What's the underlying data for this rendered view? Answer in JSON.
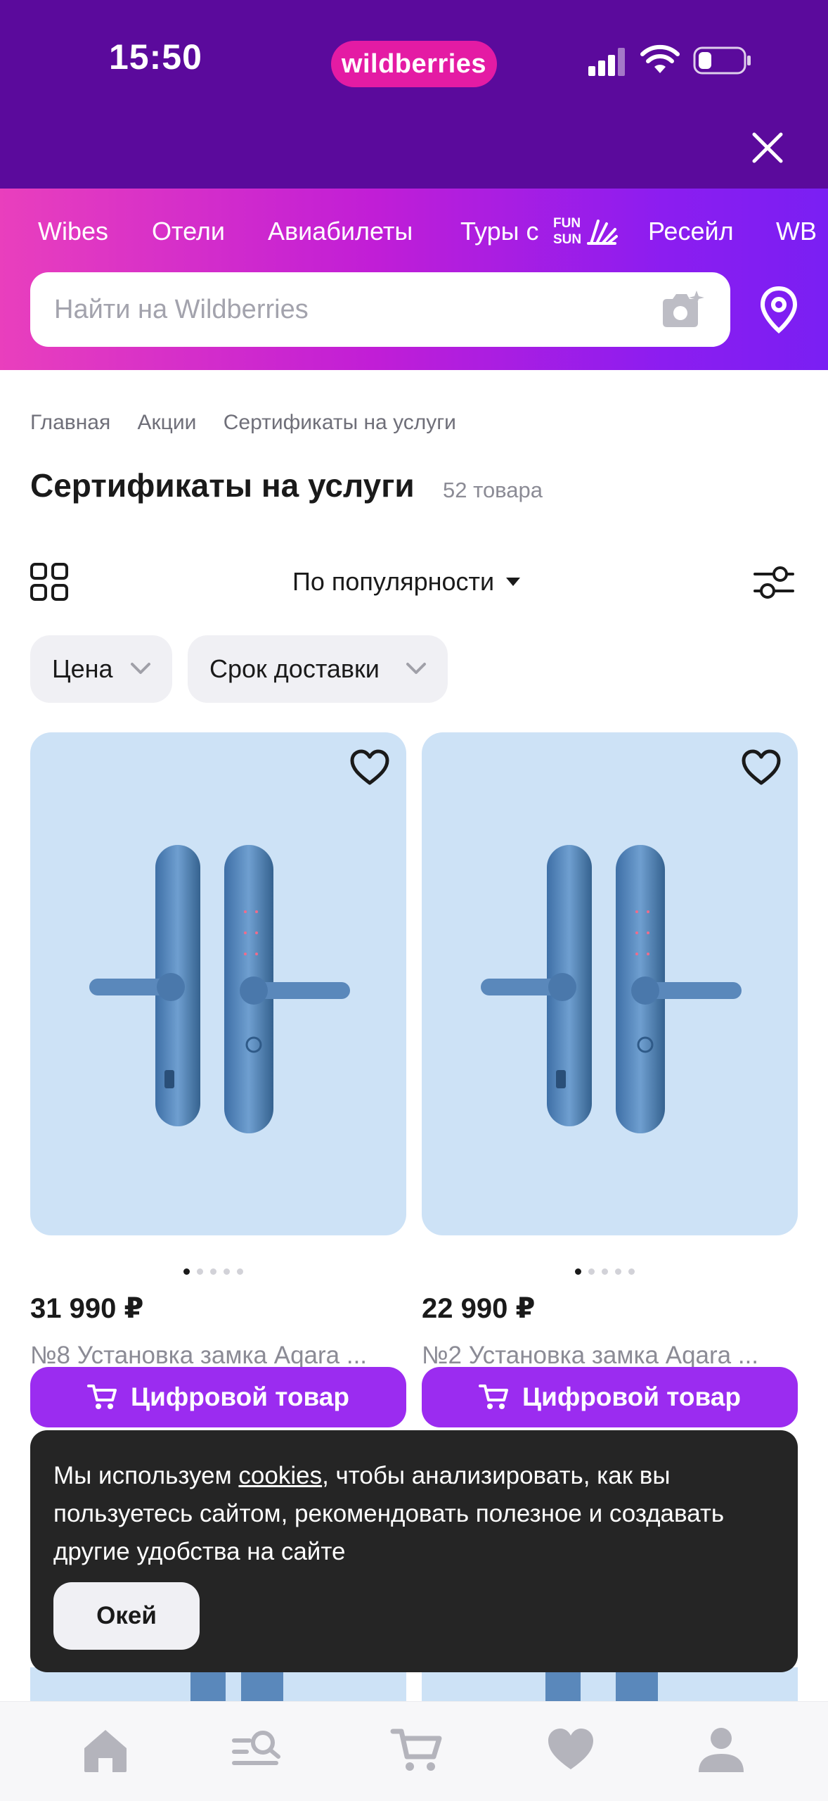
{
  "status_bar": {
    "time": "15:50",
    "app_badge": "wildberries"
  },
  "top_nav": {
    "items": [
      "Wibes",
      "Отели",
      "Авиабилеты",
      "Туры с",
      "Ресейл",
      "WB"
    ],
    "tours_logo": "FUN SUN"
  },
  "search": {
    "placeholder": "Найти на Wildberries"
  },
  "breadcrumbs": [
    "Главная",
    "Акции",
    "Сертификаты на услуги"
  ],
  "page": {
    "title": "Сертификаты на услуги",
    "count": "52 товара"
  },
  "toolbar": {
    "sort_label": "По популярности"
  },
  "filters": [
    "Цена",
    "Срок доставки"
  ],
  "products": [
    {
      "price": "31 990 ₽",
      "name": "№8 Установка замка Aqara ...",
      "button": "Цифровой товар"
    },
    {
      "price": "22 990 ₽",
      "name": "№2 Установка замка Aqara ...",
      "button": "Цифровой товар"
    }
  ],
  "cookie": {
    "text_before": "Мы используем ",
    "link": "cookies",
    "text_after": ", чтобы анализировать, как вы пользуетесь сайтом, рекомендовать полезное и создавать другие удобства на сайте",
    "ok_label": "Окей"
  },
  "tabbar": {
    "icons": [
      "home-icon",
      "catalog-search-icon",
      "cart-icon",
      "favorites-icon",
      "profile-icon"
    ]
  },
  "colors": {
    "status_bar": "#5b0a9c",
    "brand_pink": "#e41ba4",
    "button_purple": "#9b2cf0",
    "card_bg": "#cde2f6"
  }
}
